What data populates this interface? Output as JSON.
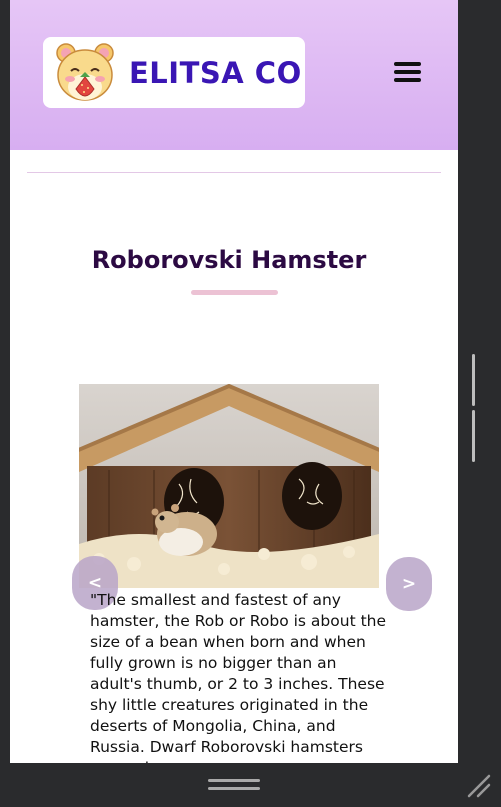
{
  "header": {
    "brand_name": "ELITSA CO",
    "logo_icon": "hamster-logo-icon",
    "menu_icon": "hamburger-menu-icon"
  },
  "section": {
    "title": "Roborovski Hamster"
  },
  "carousel": {
    "prev_label": "<",
    "next_label": ">",
    "caption": "\"The smallest and fastest of any hamster, the Rob or Robo is about the size of a bean when born and when fully grown is no bigger than an adult's thumb, or 2 to 3 inches. These shy little creatures originated in the deserts of Mongolia, China, and Russia. Dwarf Roborovski hamsters are curious"
  },
  "colors": {
    "header_gradient_top": "#e6c6f6",
    "header_gradient_bottom": "#d7aef1",
    "brand_text": "#3a16b4",
    "title_text": "#2c0a43",
    "accent_underline": "#ecc2d4",
    "frame": "#2a2b2d"
  }
}
